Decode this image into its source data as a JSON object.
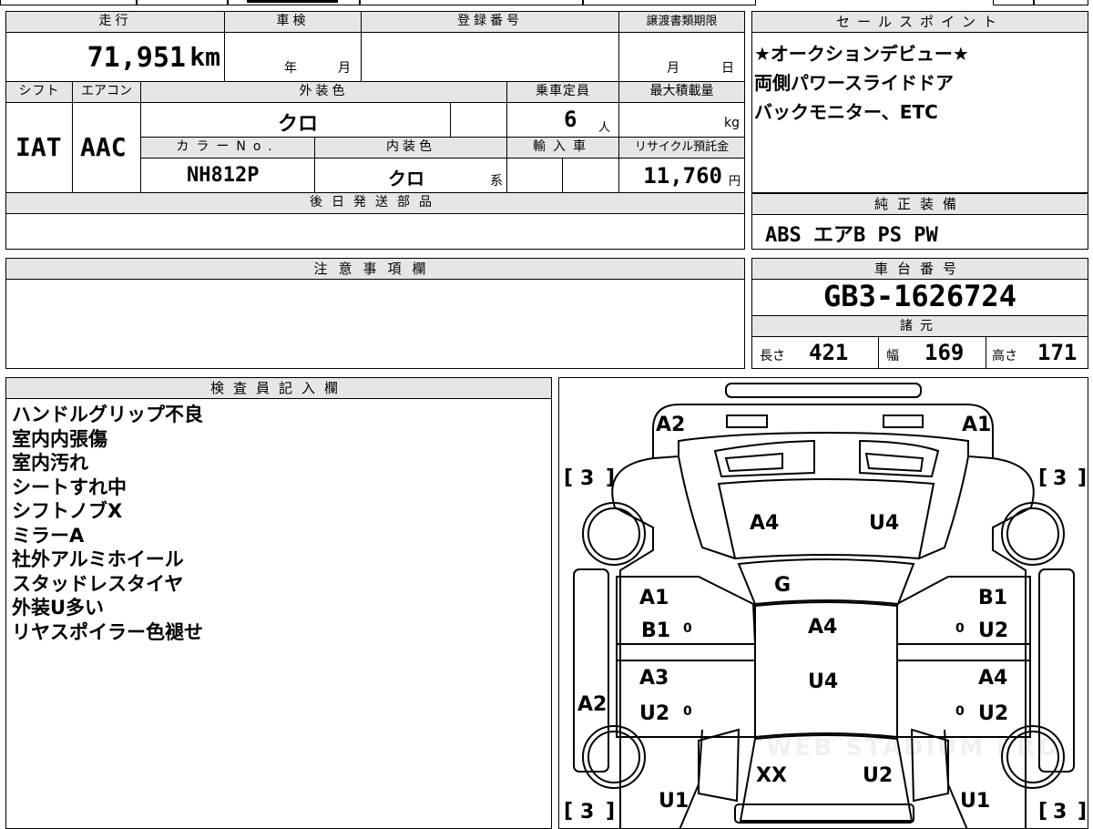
{
  "vehicle": {
    "labels": {
      "mileage": "走行",
      "shaken": "車検",
      "registration": "登録番号",
      "transfer_deadline": "譲渡書類期限",
      "shift": "シフト",
      "aircon": "エアコン",
      "exterior_color": "外装色",
      "capacity": "乗車定員",
      "max_load": "最大積載量",
      "color_no": "カラーNo.",
      "interior_color": "内装色",
      "import": "輸入車",
      "recycle_fee": "リサイクル預託金",
      "later_parts": "後日発送部品"
    },
    "mileage": "71,951",
    "mileage_unit": "km",
    "shaken_year_unit": "年",
    "shaken_month_unit": "月",
    "transfer_month_unit": "月",
    "transfer_day_unit": "日",
    "shift": "IAT",
    "aircon": "AAC",
    "exterior_color": "クロ",
    "capacity": "6",
    "capacity_unit": "人",
    "max_load_unit": "kg",
    "color_no": "NH812P",
    "interior_color": "クロ",
    "interior_color_suffix": "系",
    "recycle_fee": "11,760",
    "recycle_fee_unit": "円"
  },
  "sales_points": {
    "title": "セールスポイント",
    "lines": [
      "★オークションデビュー★",
      "両側パワースライドドア",
      "バックモニター、ETC"
    ]
  },
  "genuine_equipment": {
    "title": "純正装備",
    "value": "ABS エアB PS PW"
  },
  "notes": {
    "title": "注意事項欄"
  },
  "chassis": {
    "title": "車台番号",
    "value": "GB3-1626724",
    "specs_title": "諸元",
    "length_label": "長さ",
    "length": "421",
    "width_label": "幅",
    "width": "169",
    "height_label": "高さ",
    "height": "171"
  },
  "inspector": {
    "title": "検査員記入欄",
    "lines": [
      "ハンドルグリップ不良",
      "室内内張傷",
      "室内汚れ",
      "シートすれ中",
      "シフトノブX",
      "ミラーA",
      "社外アルミホイール",
      "スタッドレスタイヤ",
      "外装U多い",
      "リヤスポイラー色褪せ"
    ]
  },
  "diagram": {
    "front_left_corner": "A2",
    "front_right_corner": "A1",
    "tire_fl": "3",
    "tire_fr": "3",
    "tire_rl": "3",
    "tire_rr": "3",
    "hood_left": "A4",
    "hood_right": "U4",
    "windshield": "G",
    "roof_top": "A4",
    "roof_bottom": "U4",
    "left_front_door_1": "A1",
    "left_front_door_2": "B1",
    "left_rear_door_1": "A3",
    "left_rear_door_2": "U2",
    "right_front_door_1": "B1",
    "right_front_door_2": "U2",
    "right_rear_door_1": "A4",
    "right_rear_door_2": "U2",
    "left_side": "A2",
    "rear_left": "XX",
    "rear_right": "U2",
    "rear_left_corner": "U1",
    "rear_right_corner": "U1",
    "marks": "0",
    "watermark": "WEB STADIUM PRO"
  }
}
